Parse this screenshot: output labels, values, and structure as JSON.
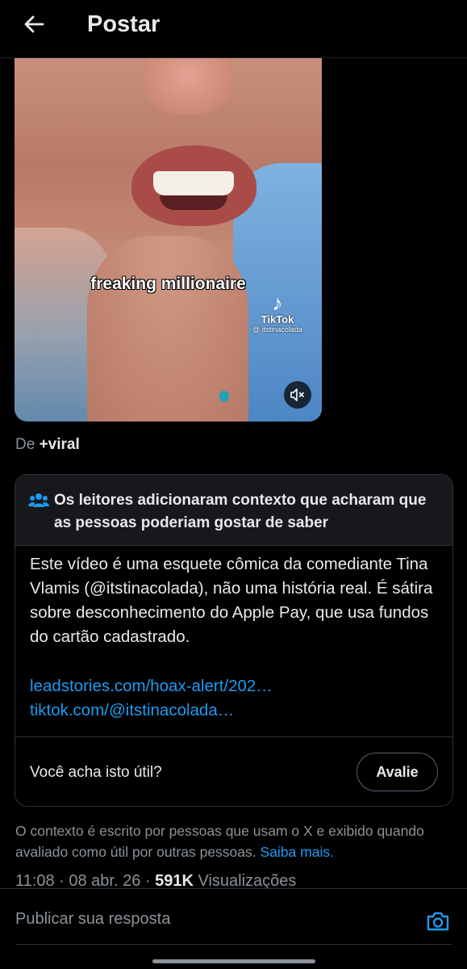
{
  "header": {
    "back_icon": "arrow-left-icon",
    "title": "Postar"
  },
  "video": {
    "caption": "freaking millionaire",
    "watermark_brand": "TikTok",
    "watermark_handle": "@ itstinacolada",
    "mute_icon": "speaker-muted-icon"
  },
  "source": {
    "prefix": "De",
    "name": "+viral"
  },
  "community_note": {
    "icon": "people-icon",
    "title": "Os leitores adicionaram contexto que acharam que as pessoas poderiam gostar de saber",
    "body": "Este vídeo é uma esquete cômica da comediante Tina Vlamis (@itstinacolada), não uma história real. É sátira sobre desconhecimento do Apple Pay, que usa fundos do cartão cadastrado.",
    "links": [
      "leadstories.com/hoax-alert/202…",
      "tiktok.com/@itstinacolada…"
    ],
    "helpful_question": "Você acha isto útil?",
    "rate_label": "Avalie"
  },
  "disclaimer": {
    "text": "O contexto é escrito por pessoas que usam o X e exibido quando avaliado como útil por outras pessoas.",
    "link": "Saiba mais."
  },
  "meta": {
    "time": "11:08",
    "date": "08 abr. 26",
    "views_count": "591K",
    "views_label": "Visualizações"
  },
  "reply": {
    "placeholder": "Publicar sua resposta",
    "camera_icon": "camera-icon"
  },
  "colors": {
    "background": "#000000",
    "accent": "#1d9bf0",
    "muted_text": "#8b9299"
  }
}
